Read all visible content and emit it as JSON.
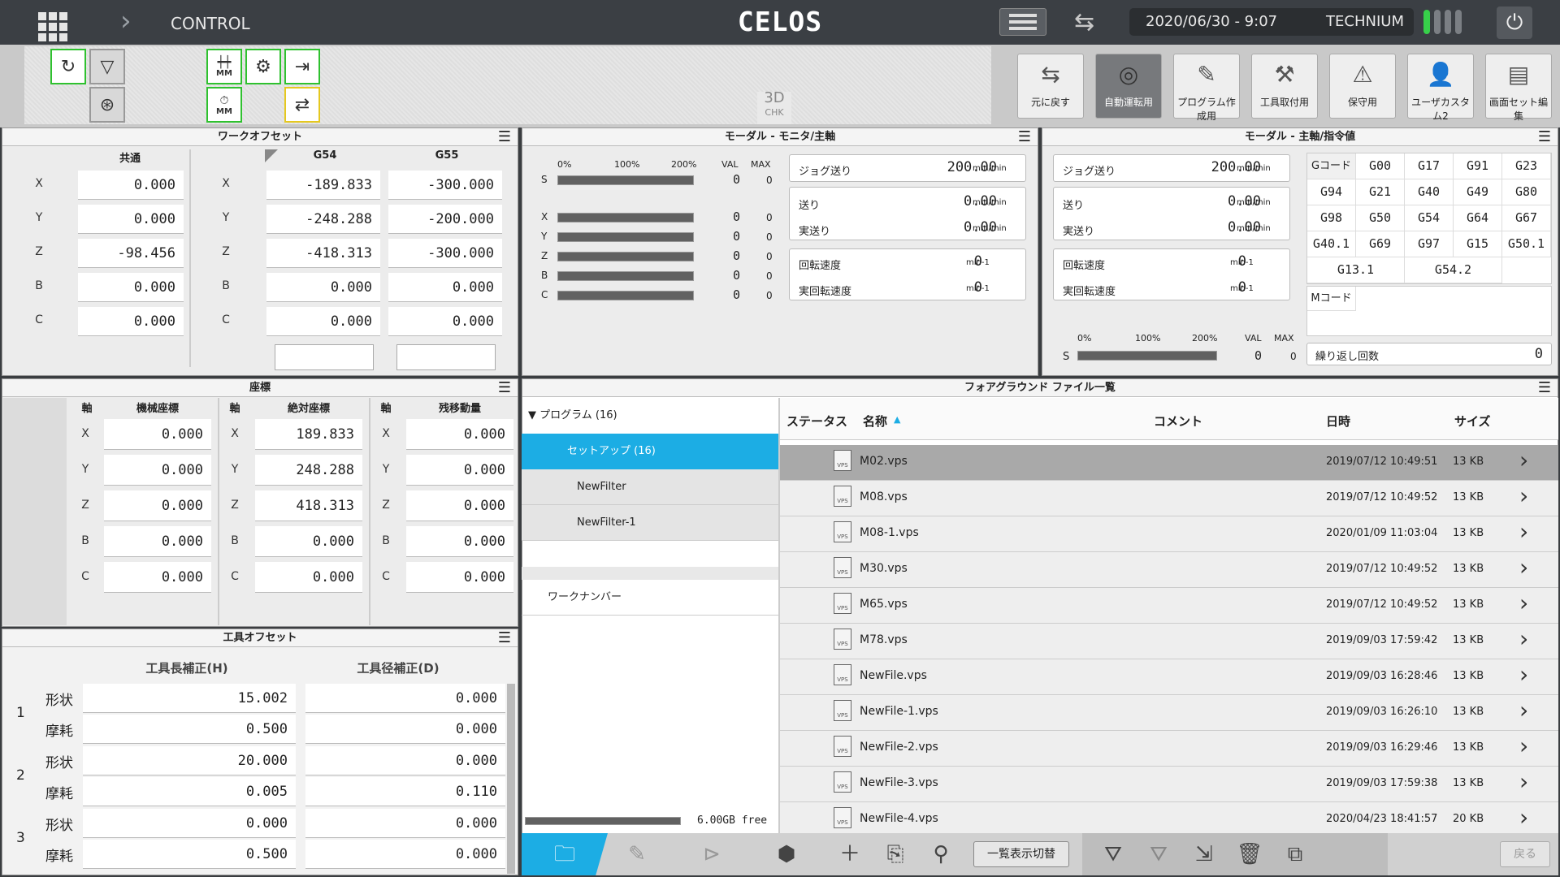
{
  "header": {
    "app_label": "CONTROL",
    "logo": "CELOS",
    "datetime": "2020/06/30 - 9:07",
    "user": "TECHNIUM",
    "icons": [
      "app-grid-icon",
      "chevron-right-icon",
      "hamburger-icon",
      "swap-icon",
      "power-icon"
    ]
  },
  "toolbar": {
    "right_buttons": [
      {
        "label": "元に戻す",
        "icon": "undo-icon"
      },
      {
        "label": "自動運転用",
        "icon": "auto-run-icon"
      },
      {
        "label": "プログラム作成用",
        "icon": "program-edit-icon"
      },
      {
        "label": "工具取付用",
        "icon": "tool-mount-icon"
      },
      {
        "label": "保守用",
        "icon": "maintenance-icon"
      },
      {
        "label": "ユーザカスタム2",
        "icon": "user-custom-icon"
      },
      {
        "label": "画面セット編集",
        "icon": "screen-set-icon"
      }
    ],
    "check3d": "3D",
    "check3d_sub": "CHK",
    "mm_label": "MM"
  },
  "work_offset": {
    "title": "ワークオフセット",
    "common_label": "共通",
    "g54_label": "G54",
    "g55_label": "G55",
    "axes": [
      "X",
      "Y",
      "Z",
      "B",
      "C"
    ],
    "common": [
      "0.000",
      "0.000",
      "-98.456",
      "0.000",
      "0.000"
    ],
    "g54": [
      "-189.833",
      "-248.288",
      "-418.313",
      "0.000",
      "0.000"
    ],
    "g55": [
      "-300.000",
      "-200.000",
      "-300.000",
      "0.000",
      "0.000"
    ]
  },
  "modal_monitor": {
    "title": "モーダル - モニタ/主軸",
    "pct0": "0%",
    "pct100": "100%",
    "pct200": "200%",
    "val": "VAL",
    "max": "MAX",
    "rows": [
      {
        "axis": "S",
        "val": "0",
        "max": "0"
      },
      {
        "axis": "X",
        "val": "0",
        "max": "0"
      },
      {
        "axis": "Y",
        "val": "0",
        "max": "0"
      },
      {
        "axis": "Z",
        "val": "0",
        "max": "0"
      },
      {
        "axis": "B",
        "val": "0",
        "max": "0"
      },
      {
        "axis": "C",
        "val": "0",
        "max": "0"
      }
    ],
    "jog_label": "ジョグ送り",
    "jog_value": "200.00",
    "feed_label": "送り",
    "feed_value": "0.00",
    "actual_feed_label": "実送り",
    "actual_feed_value": "0.00",
    "unit_mm": "mm/min",
    "rot_label": "回転速度",
    "rot_value": "0",
    "actual_rot_label": "実回転速度",
    "actual_rot_value": "0",
    "unit_rpm": "min-1"
  },
  "modal_spindle": {
    "title": "モーダル - 主軸/指令値",
    "gcode_label": "Gコード",
    "gcodes": [
      "G00",
      "G17",
      "G91",
      "G23",
      "G94",
      "G21",
      "G40",
      "G49",
      "G80",
      "G98",
      "G50",
      "G54",
      "G64",
      "G67",
      "G40.1",
      "G69",
      "G97",
      "G15",
      "G50.1",
      "G13.1",
      "G54.2"
    ],
    "mcode_label": "Mコード",
    "repeat_label": "繰り返し回数",
    "repeat_value": "0",
    "s_label": "S",
    "s_val": "0",
    "s_max": "0"
  },
  "coords": {
    "title": "座標",
    "axis_label": "軸",
    "machine_label": "機械座標",
    "abs_label": "絶対座標",
    "remain_label": "残移動量",
    "axes": [
      "X",
      "Y",
      "Z",
      "B",
      "C"
    ],
    "machine": [
      "0.000",
      "0.000",
      "0.000",
      "0.000",
      "0.000"
    ],
    "absolute": [
      "189.833",
      "248.288",
      "418.313",
      "0.000",
      "0.000"
    ],
    "remain": [
      "0.000",
      "0.000",
      "0.000",
      "0.000",
      "0.000"
    ]
  },
  "tool_offset": {
    "title": "工具オフセット",
    "length_label": "工具長補正(H)",
    "radius_label": "工具径補正(D)",
    "shape_label": "形状",
    "wear_label": "摩耗",
    "rows": [
      {
        "no": "1",
        "shape_h": "15.002",
        "shape_d": "0.000",
        "wear_h": "0.500",
        "wear_d": "0.000"
      },
      {
        "no": "2",
        "shape_h": "20.000",
        "shape_d": "0.000",
        "wear_h": "0.005",
        "wear_d": "0.110"
      },
      {
        "no": "3",
        "shape_h": "0.000",
        "shape_d": "0.000",
        "wear_h": "0.500",
        "wear_d": "0.000"
      }
    ]
  },
  "files": {
    "title": "フォアグラウンド ファイル一覧",
    "tree_root": "プログラム (16)",
    "tree_items": [
      "セットアップ (16)",
      "NewFilter",
      "NewFilter-1"
    ],
    "work_number": "ワークナンバー",
    "disk_free": "6.00GB free",
    "col_status": "ステータス",
    "col_name": "名称",
    "col_comment": "コメント",
    "col_date": "日時",
    "col_size": "サイズ",
    "rows": [
      {
        "name": "M02.vps",
        "date": "2019/07/12 10:49:51",
        "size": "13 KB"
      },
      {
        "name": "M08.vps",
        "date": "2019/07/12 10:49:52",
        "size": "13 KB"
      },
      {
        "name": "M08-1.vps",
        "date": "2020/01/09 11:03:04",
        "size": "13 KB"
      },
      {
        "name": "M30.vps",
        "date": "2019/07/12 10:49:52",
        "size": "13 KB"
      },
      {
        "name": "M65.vps",
        "date": "2019/07/12 10:49:52",
        "size": "13 KB"
      },
      {
        "name": "M78.vps",
        "date": "2019/09/03 17:59:42",
        "size": "13 KB"
      },
      {
        "name": "NewFile.vps",
        "date": "2019/09/03 16:28:46",
        "size": "13 KB"
      },
      {
        "name": "NewFile-1.vps",
        "date": "2019/09/03 16:26:10",
        "size": "13 KB"
      },
      {
        "name": "NewFile-2.vps",
        "date": "2019/09/03 16:29:46",
        "size": "13 KB"
      },
      {
        "name": "NewFile-3.vps",
        "date": "2019/09/03 17:59:38",
        "size": "13 KB"
      },
      {
        "name": "NewFile-4.vps",
        "date": "2020/04/23 18:41:57",
        "size": "20 KB"
      }
    ],
    "list_toggle": "一覧表示切替",
    "back": "戻る",
    "file_icon_text": "VPS"
  }
}
